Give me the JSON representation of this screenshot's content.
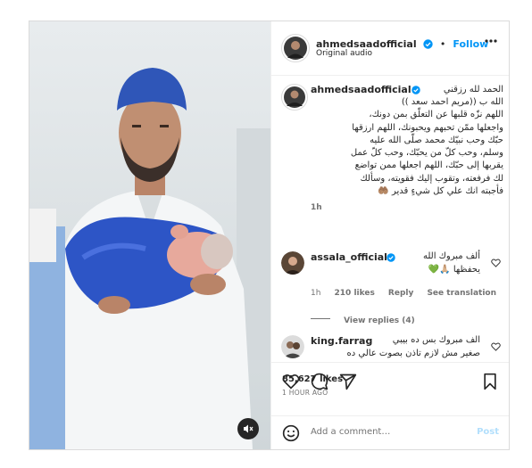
{
  "post": {
    "author": "ahmedsaadofficial",
    "follow_label": "Follow",
    "audio": "Original audio",
    "more_icon": "more-horizontal-icon",
    "verified_color": "#0095f6",
    "caption_lines": [
      "الحمد لله رزقني",
      "الله ب ((مريم احمد سعد ))",
      "اللهم نزّه قلبها عن التعلّق بمن دونك،",
      "واجعلها ممّن تحبهم ويحبونك، اللهم ارزقها",
      "حبّك وحب نبيّك محمد صلّى الله عليه",
      "وسلم، وحب كلّ من يحبّك، وحب كلّ عمل",
      "يقربها إلى حبّك، اللهم اجعلها ممن تواضع",
      "لك فرفعته، وتقوب إليك فقويته، وسألك",
      "فأجبته انك علي كل شيءٍ قدير 🤲🏽"
    ],
    "caption_time": "1h"
  },
  "comments": [
    {
      "user": "assala_official",
      "verified": true,
      "lines": [
        "ألف مبروك الله",
        "يحفظها 🙏🏼💚"
      ],
      "time": "1h",
      "likes": "210 likes",
      "reply": "Reply",
      "translate": "See translation",
      "view_replies": "View replies (4)"
    },
    {
      "user": "king.farrag",
      "verified": false,
      "lines": [
        "الف مبروك بس ده بيبي",
        "صغير مش لازم تاذن بصوت عالي ده"
      ]
    }
  ],
  "actions": {
    "icons": [
      "heart-icon",
      "comment-icon",
      "share-icon",
      "bookmark-icon"
    ],
    "likes": "85,627 likes",
    "time": "1 HOUR AGO"
  },
  "add_comment": {
    "placeholder": "Add a comment…",
    "post_label": "Post",
    "emoji_icon": "emoji-icon"
  },
  "media": {
    "mute_icon": "speaker-muted-icon"
  }
}
